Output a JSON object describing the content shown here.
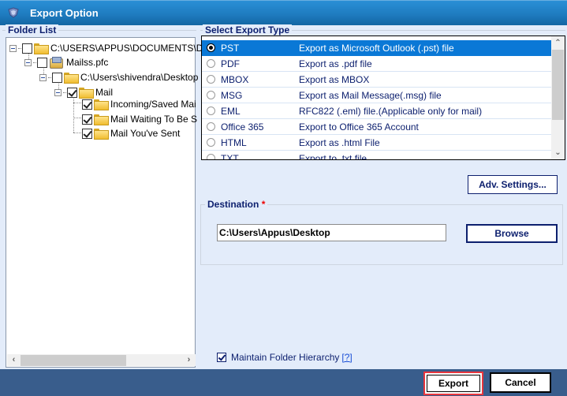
{
  "window": {
    "title": "Export Option",
    "icon": "app-shield-icon"
  },
  "folder_list": {
    "label": "Folder List",
    "nodes": [
      {
        "label": "C:\\USERS\\APPUS\\DOCUMENTS\\DC",
        "icon": "open-folder-icon",
        "checked": false,
        "expanded": true,
        "level": 0
      },
      {
        "label": "Mailss.pfc",
        "icon": "pst-file-icon",
        "checked": false,
        "expanded": true,
        "level": 1
      },
      {
        "label": "C:\\Users\\shivendra\\Desktop",
        "icon": "folder-icon",
        "checked": false,
        "expanded": true,
        "level": 2
      },
      {
        "label": "Mail",
        "icon": "folder-icon",
        "checked": true,
        "expanded": true,
        "level": 3
      },
      {
        "label": "Incoming/Saved Mai",
        "icon": "folder-icon",
        "checked": true,
        "level": 4
      },
      {
        "label": "Mail Waiting To Be S",
        "icon": "folder-icon",
        "checked": true,
        "level": 4
      },
      {
        "label": "Mail You've Sent",
        "icon": "folder-icon",
        "checked": true,
        "level": 4
      }
    ]
  },
  "export_type": {
    "label": "Select Export Type",
    "selected": "PST",
    "options": [
      {
        "name": "PST",
        "description": "Export as Microsoft Outlook (.pst) file"
      },
      {
        "name": "PDF",
        "description": "Export as .pdf file"
      },
      {
        "name": "MBOX",
        "description": "Export as MBOX"
      },
      {
        "name": "MSG",
        "description": "Export as Mail Message(.msg) file"
      },
      {
        "name": "EML",
        "description": "RFC822 (.eml) file.(Applicable only for mail)"
      },
      {
        "name": "Office 365",
        "description": "Export to Office 365 Account"
      },
      {
        "name": "HTML",
        "description": "Export as .html File"
      },
      {
        "name": "TXT",
        "description": "Export to .txt file"
      }
    ]
  },
  "adv_settings_label": "Adv. Settings...",
  "destination": {
    "label": "Destination",
    "required_marker": "*",
    "path": "C:\\Users\\Appus\\Desktop",
    "browse_label": "Browse"
  },
  "maintain_hierarchy": {
    "label": "Maintain Folder Hierarchy",
    "checked": true,
    "help": "[?]"
  },
  "footer": {
    "export_label": "Export",
    "cancel_label": "Cancel"
  },
  "colors": {
    "titlebar": "#1f7cc0",
    "selection": "#0a78d6",
    "footer": "#395d8c",
    "accent_text": "#0c1f6e",
    "highlight_border": "#e8363d"
  }
}
